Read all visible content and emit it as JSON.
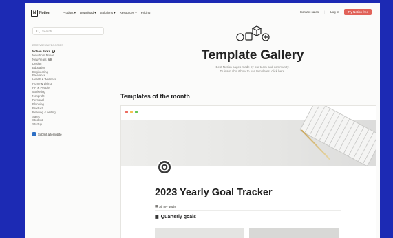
{
  "colors": {
    "background": "#1c2ab4",
    "accent": "#e16259"
  },
  "header": {
    "brand": "Notion",
    "nav": [
      "Product",
      "Download",
      "Solutions",
      "Resources",
      "Pricing"
    ],
    "contact_sales": "Contact sales",
    "login": "Log in",
    "cta": "Try Notion free"
  },
  "sidebar": {
    "search_placeholder": "Search",
    "section_label": "BROWSE CATEGORIES",
    "items": [
      "Notion Picks",
      "New from Notion",
      "New Years",
      "Design",
      "Education",
      "Engineering",
      "Freelance",
      "Health & Wellness",
      "Home & Living",
      "HR & People",
      "Marketing",
      "Nonprofit",
      "Personal",
      "Planning",
      "Product",
      "Reading & writing",
      "Sales",
      "Student",
      "Startup"
    ],
    "submit": "Submit a template"
  },
  "hero": {
    "title": "Template Gallery",
    "subtitle_line1": "Best Notion pages made by our team and community.",
    "subtitle_line2": "To learn about how to use templates, click here."
  },
  "section": {
    "title": "Templates of the month"
  },
  "card": {
    "page_title": "2023 Yearly Goal Tracker",
    "view_tab": "All my goals",
    "sub_title": "Quarterly goals",
    "icon": "target-icon"
  }
}
